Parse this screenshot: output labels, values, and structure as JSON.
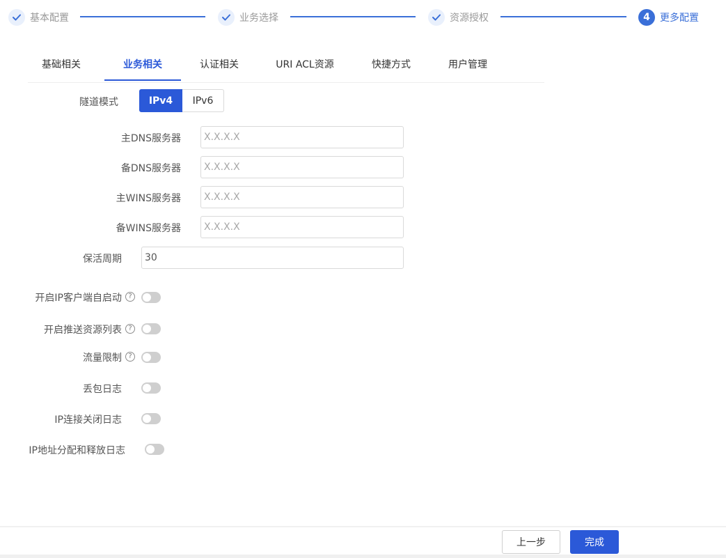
{
  "steps": [
    {
      "label": "基本配置",
      "status": "done",
      "icon": "check-icon"
    },
    {
      "label": "业务选择",
      "status": "done",
      "icon": "check-icon"
    },
    {
      "label": "资源授权",
      "status": "done",
      "icon": "check-icon"
    },
    {
      "label": "更多配置",
      "status": "active",
      "number": "4"
    }
  ],
  "tabs": [
    {
      "label": "基础相关"
    },
    {
      "label": "业务相关"
    },
    {
      "label": "认证相关"
    },
    {
      "label": "URI ACL资源"
    },
    {
      "label": "快捷方式"
    },
    {
      "label": "用户管理"
    }
  ],
  "active_tab": "业务相关",
  "form": {
    "tunnel_mode": {
      "label": "隧道模式",
      "options": [
        "IPv4",
        "IPv6"
      ],
      "selected": "IPv4"
    },
    "primary_dns": {
      "label": "主DNS服务器",
      "value": "",
      "placeholder": "X.X.X.X"
    },
    "secondary_dns": {
      "label": "备DNS服务器",
      "value": "",
      "placeholder": "X.X.X.X"
    },
    "primary_wins": {
      "label": "主WINS服务器",
      "value": "",
      "placeholder": "X.X.X.X"
    },
    "secondary_wins": {
      "label": "备WINS服务器",
      "value": "",
      "placeholder": "X.X.X.X"
    },
    "keepalive": {
      "label": "保活周期",
      "value": "30"
    },
    "toggles": [
      {
        "label": "开启IP客户端自启动",
        "help": true,
        "on": false
      },
      {
        "label": "开启推送资源列表",
        "help": true,
        "on": false
      },
      {
        "label": "流量限制",
        "help": true,
        "on": false
      },
      {
        "label": "丢包日志",
        "help": false,
        "on": false
      },
      {
        "label": "IP连接关闭日志",
        "help": false,
        "on": false
      },
      {
        "label": "IP地址分配和释放日志",
        "help": false,
        "on": false
      }
    ],
    "help_glyph": "?"
  },
  "footer": {
    "prev_label": "上一步",
    "finish_label": "完成"
  },
  "colors": {
    "primary": "#2b59d8",
    "step_accent": "#3a6fd8",
    "toggle_off": "#cfcfcf"
  }
}
